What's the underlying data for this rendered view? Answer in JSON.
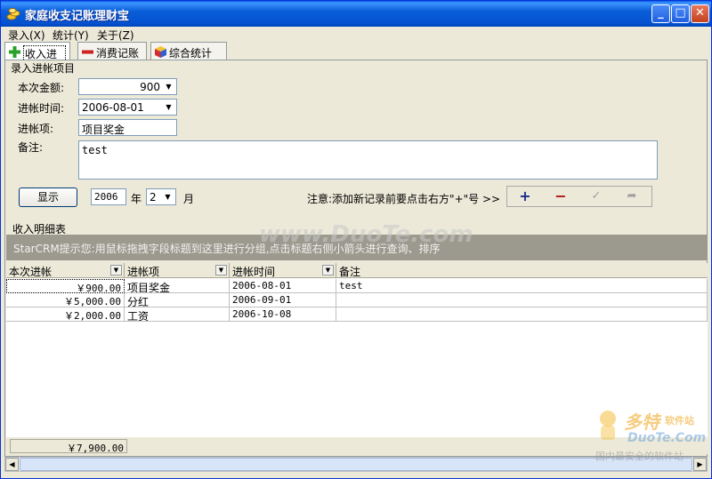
{
  "window": {
    "title": "家庭收支记账理财宝",
    "minimize_icon": "minimize-icon",
    "maximize_icon": "maximize-icon",
    "close_icon": "close-icon"
  },
  "menu": [
    "录入(X)",
    "统计(Y)",
    "关于(Z)"
  ],
  "tabs": [
    {
      "label": "收入进帐",
      "icon": "plus-icon"
    },
    {
      "label": "消费记账",
      "icon": "minus-icon"
    },
    {
      "label": "综合统计",
      "icon": "cube-icon"
    }
  ],
  "entry_group": {
    "title": "录入进帐项目",
    "amount_label": "本次金额:",
    "amount_value": "900",
    "date_label": "进帐时间:",
    "date_value": "2006-08-01",
    "item_label": "进帐项:",
    "item_value": "项目奖金",
    "memo_label": "备注:",
    "memo_value": "test"
  },
  "filter": {
    "show_button": "显示",
    "year_value": "2006",
    "year_label": "年",
    "month_value": "2",
    "month_label": "月",
    "notice": "注意:添加新记录前要点击右方\"+\"号 >>"
  },
  "nav": [
    {
      "symbol": "+",
      "icon": "add-record-icon"
    },
    {
      "symbol": "−",
      "icon": "delete-record-icon"
    },
    {
      "symbol": "✓",
      "icon": "confirm-icon"
    },
    {
      "symbol": "➦",
      "icon": "cancel-edit-icon"
    }
  ],
  "detail": {
    "title": "收入明细表",
    "hint": "StarCRM提示您:用鼠标拖拽字段标题到这里进行分组,点击标题右侧小箭头进行查询、排序",
    "columns": [
      "本次进帐",
      "进帐项",
      "进帐时间",
      "备注"
    ],
    "rows": [
      [
        "￥900.00",
        "项目奖金",
        "2006-08-01",
        "test"
      ],
      [
        "￥5,000.00",
        "分红",
        "2006-09-01",
        ""
      ],
      [
        "￥2,000.00",
        "工资",
        "2006-10-08",
        ""
      ]
    ],
    "total": "￥7,900.00"
  },
  "watermarks": {
    "center": "www.DuoTe.com",
    "logo_main": "多特",
    "logo_sub": "软件站",
    "logo_url": "DuoTe.Com",
    "logo_tagline": "国内最安全的软件站"
  }
}
